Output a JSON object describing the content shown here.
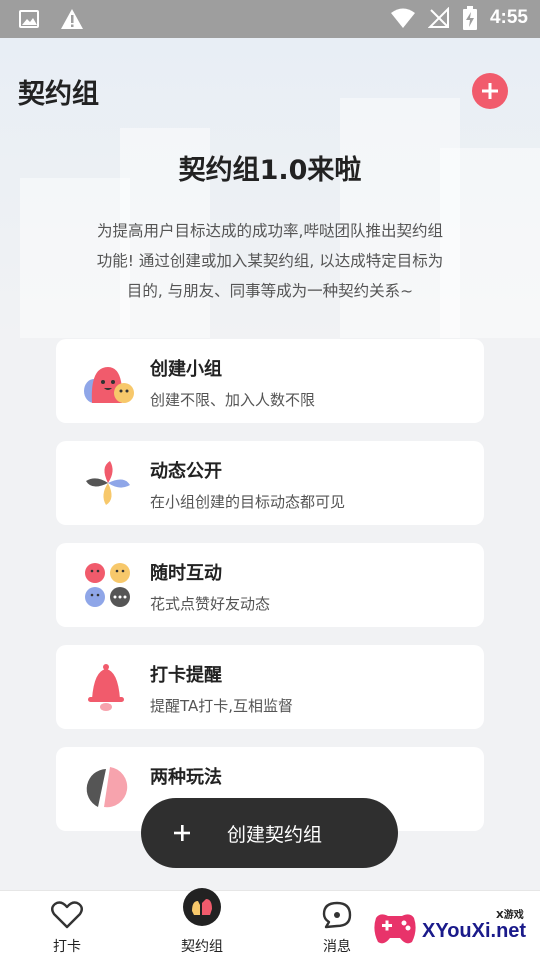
{
  "status_bar": {
    "time": "4:55"
  },
  "header": {
    "title": "契约组"
  },
  "hero": {
    "title": "契约组1.0来啦",
    "description_lines": [
      "为提高用户目标达成的成功率,哔哒团队推出契约组",
      "功能! 通过创建或加入某契约组, 以达成特定目标为",
      "目的, 与朋友、同事等成为一种契约关系~"
    ]
  },
  "features": [
    {
      "title": "创建小组",
      "subtitle": "创建不限、加入人数不限",
      "icon": "group-faces-icon"
    },
    {
      "title": "动态公开",
      "subtitle": "在小组创建的目标动态都可见",
      "icon": "pinwheel-icon"
    },
    {
      "title": "随时互动",
      "subtitle": "花式点赞好友动态",
      "icon": "emoji-faces-icon"
    },
    {
      "title": "打卡提醒",
      "subtitle": "提醒TA打卡,互相监督",
      "icon": "bell-icon"
    },
    {
      "title": "两种玩法",
      "subtitle": "",
      "icon": "split-circle-icon"
    }
  ],
  "fab": {
    "label": "创建契约组"
  },
  "tabs": [
    {
      "label": "打卡",
      "icon": "heart-outline-icon"
    },
    {
      "label": "契约组",
      "icon": "handshake-icon"
    },
    {
      "label": "消息",
      "icon": "chat-bubble-icon"
    }
  ],
  "watermark": {
    "text": "XYouXi.net",
    "small": "X游戏"
  },
  "colors": {
    "accent": "#f15b6c",
    "fab_bg": "#2f2f2f",
    "status_bar": "#9e9e9e"
  }
}
